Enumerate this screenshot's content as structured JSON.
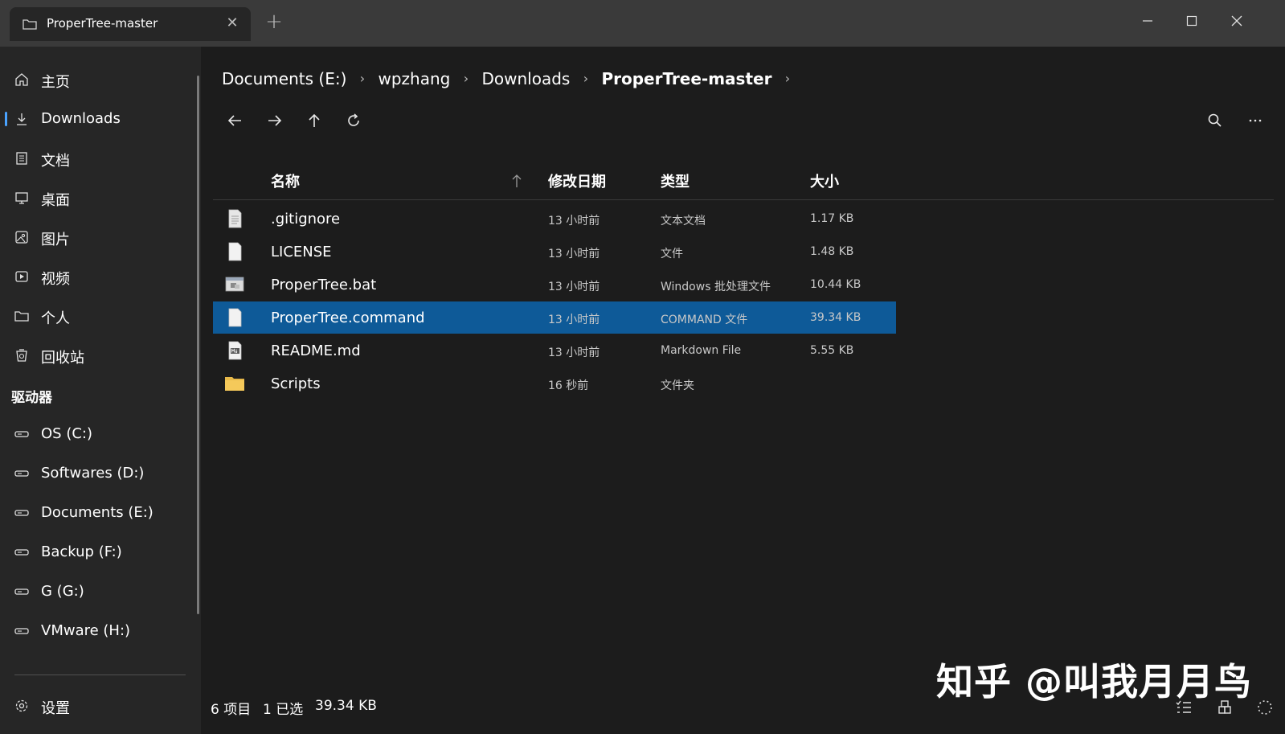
{
  "window": {
    "tab_title": "ProperTree-master",
    "tab_icon": "folder-icon",
    "close_tab_icon": "close-icon",
    "new_tab_icon": "plus-icon",
    "controls": [
      "minimize-icon",
      "maximize-icon",
      "close-icon"
    ]
  },
  "sidebar": {
    "items": [
      {
        "label": "主页",
        "icon": "home-icon"
      },
      {
        "label": "Downloads",
        "icon": "download-icon",
        "active": true
      },
      {
        "label": "文档",
        "icon": "document-icon"
      },
      {
        "label": "桌面",
        "icon": "desktop-icon"
      },
      {
        "label": "图片",
        "icon": "picture-icon"
      },
      {
        "label": "视频",
        "icon": "video-icon"
      },
      {
        "label": "个人",
        "icon": "folder-icon"
      },
      {
        "label": "回收站",
        "icon": "recycle-bin-icon"
      }
    ],
    "drives_title": "驱动器",
    "drives": [
      {
        "label": "OS (C:)",
        "icon": "drive-icon"
      },
      {
        "label": "Softwares (D:)",
        "icon": "drive-icon"
      },
      {
        "label": "Documents (E:)",
        "icon": "drive-icon"
      },
      {
        "label": "Backup (F:)",
        "icon": "drive-icon"
      },
      {
        "label": "G (G:)",
        "icon": "drive-icon"
      },
      {
        "label": "VMware (H:)",
        "icon": "drive-icon"
      }
    ],
    "settings_label": "设置",
    "settings_icon": "gear-icon"
  },
  "breadcrumb": [
    "Documents (E:)",
    "wpzhang",
    "Downloads",
    "ProperTree-master"
  ],
  "toolbar": {
    "left": [
      "back-arrow-icon",
      "forward-arrow-icon",
      "up-arrow-icon",
      "refresh-icon"
    ],
    "right": [
      "search-icon",
      "more-icon"
    ]
  },
  "columns": {
    "name": "名称",
    "date": "修改日期",
    "type": "类型",
    "size": "大小",
    "sort_icon": "sort-ascending-icon"
  },
  "files": [
    {
      "name": ".gitignore",
      "date": "13 小时前",
      "type": "文本文档",
      "size": "1.17 KB",
      "icon": "text-file-icon"
    },
    {
      "name": "LICENSE",
      "date": "13 小时前",
      "type": "文件",
      "size": "1.48 KB",
      "icon": "blank-file-icon"
    },
    {
      "name": "ProperTree.bat",
      "date": "13 小时前",
      "type": "Windows 批处理文件",
      "size": "10.44 KB",
      "icon": "batch-file-icon"
    },
    {
      "name": "ProperTree.command",
      "date": "13 小时前",
      "type": "COMMAND 文件",
      "size": "39.34 KB",
      "icon": "blank-file-icon",
      "selected": true
    },
    {
      "name": "README.md",
      "date": "13 小时前",
      "type": "Markdown File",
      "size": "5.55 KB",
      "icon": "markdown-file-icon"
    },
    {
      "name": "Scripts",
      "date": "16 秒前",
      "type": "文件夹",
      "size": "",
      "icon": "yellow-folder-icon"
    }
  ],
  "status": {
    "items": "6 项目",
    "selected": "1 已选",
    "size": "39.34 KB"
  },
  "watermark": "知乎 @叫我月月鸟",
  "colors": {
    "selection": "#0e5a98",
    "accent": "#4aa3ff",
    "folder": "#f5c95a"
  }
}
